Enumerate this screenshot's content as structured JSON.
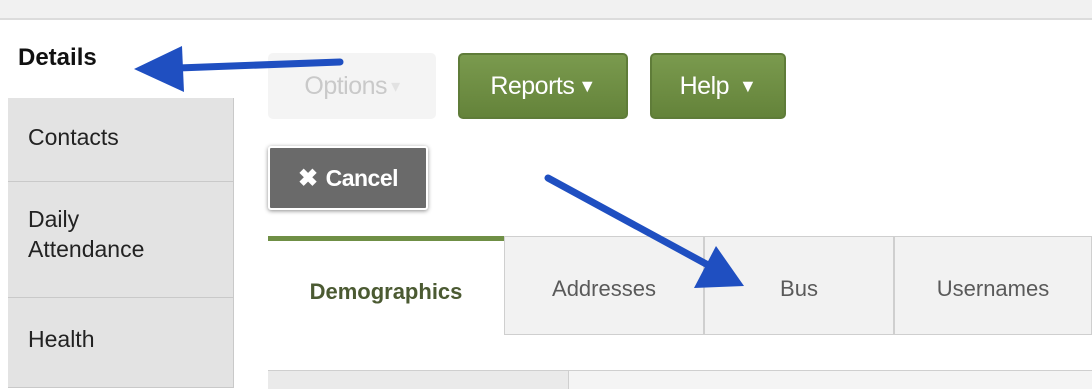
{
  "sidebar": {
    "items": [
      {
        "label": "Details",
        "active": true
      },
      {
        "label": "Contacts"
      },
      {
        "label_line1": "Daily",
        "label_line2": "Attendance"
      },
      {
        "label": "Health"
      }
    ]
  },
  "toolbar": {
    "options_label": "Options",
    "reports_label": "Reports",
    "help_label": "Help",
    "cancel_label": "Cancel"
  },
  "tabs": [
    {
      "label": "Demographics",
      "active": true
    },
    {
      "label": "Addresses"
    },
    {
      "label": "Bus"
    },
    {
      "label": "Usernames"
    }
  ],
  "colors": {
    "accent_green": "#6f8f45",
    "annotation_arrow": "#1f4fc1"
  }
}
